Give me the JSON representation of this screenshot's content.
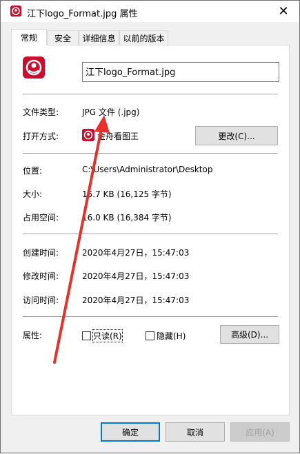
{
  "window": {
    "title": "江下logo_Format.jpg 属性",
    "close_glyph": "✕"
  },
  "tabs": [
    {
      "label": "常规",
      "active": true
    },
    {
      "label": "安全",
      "active": false
    },
    {
      "label": "详细信息",
      "active": false
    },
    {
      "label": "以前的版本",
      "active": false
    }
  ],
  "file": {
    "name": "江下logo_Format.jpg",
    "type_label": "文件类型:",
    "type_value": "JPG 文件 (.jpg)",
    "openwith_label": "打开方式:",
    "openwith_value": "金舟看图王",
    "change_button": "更改(C)...",
    "location_label": "位置:",
    "location_value": "C:\\Users\\Administrator\\Desktop",
    "size_label": "大小:",
    "size_value": "15.7 KB (16,125 字节)",
    "disk_label": "占用空间:",
    "disk_value": "16.0 KB (16,384 字节)",
    "created_label": "创建时间:",
    "created_value": "2020年4月27日，15:47:03",
    "modified_label": "修改时间:",
    "modified_value": "2020年4月27日，15:47:03",
    "accessed_label": "访问时间:",
    "accessed_value": "2020年4月27日，15:47:03"
  },
  "attributes": {
    "label": "属性:",
    "readonly": "只读(R)",
    "hidden": "隐藏(H)",
    "advanced_button": "高级(D)..."
  },
  "footer": {
    "ok": "确定",
    "cancel": "取消",
    "apply": "应用(A)"
  },
  "colors": {
    "accent": "#0078d7",
    "app_icon": "#c8102e",
    "annotation_arrow": "#e8302a"
  }
}
